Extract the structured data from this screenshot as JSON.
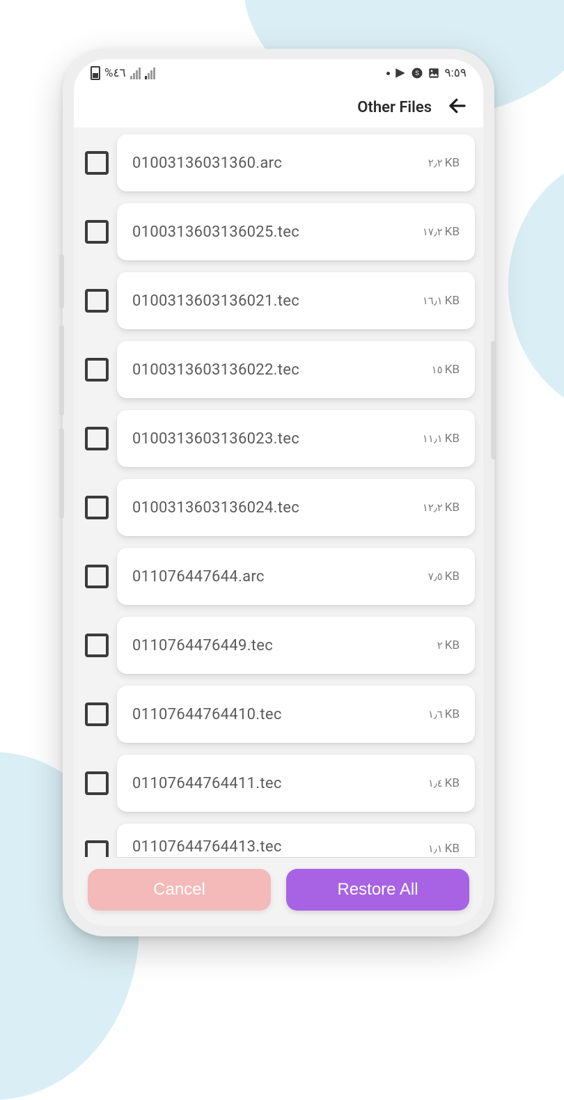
{
  "status": {
    "battery_text": "%٤٦",
    "clock": "٩:٥٩"
  },
  "header": {
    "title": "Other Files"
  },
  "files": [
    {
      "name": "01003136031360.arc",
      "size_num": "٢٫٢",
      "size_unit": "KB"
    },
    {
      "name": "0100313603136025.tec",
      "size_num": "١٧٫٢",
      "size_unit": "KB"
    },
    {
      "name": "0100313603136021.tec",
      "size_num": "١٦٫١",
      "size_unit": "KB"
    },
    {
      "name": "0100313603136022.tec",
      "size_num": "١٥",
      "size_unit": "KB"
    },
    {
      "name": "0100313603136023.tec",
      "size_num": "١١٫١",
      "size_unit": "KB"
    },
    {
      "name": "0100313603136024.tec",
      "size_num": "١٢٫٢",
      "size_unit": "KB"
    },
    {
      "name": "011076447644.arc",
      "size_num": "٧٫٥",
      "size_unit": "KB"
    },
    {
      "name": "0110764476449.tec",
      "size_num": "٢",
      "size_unit": "KB"
    },
    {
      "name": "01107644764410.tec",
      "size_num": "١٫٦",
      "size_unit": "KB"
    },
    {
      "name": "01107644764411.tec",
      "size_num": "١٫٤",
      "size_unit": "KB"
    }
  ],
  "partial": {
    "name": "01107644764413.tec",
    "size_num": "١٫١",
    "size_unit": "KB"
  },
  "buttons": {
    "cancel": "Cancel",
    "restore": "Restore All"
  }
}
